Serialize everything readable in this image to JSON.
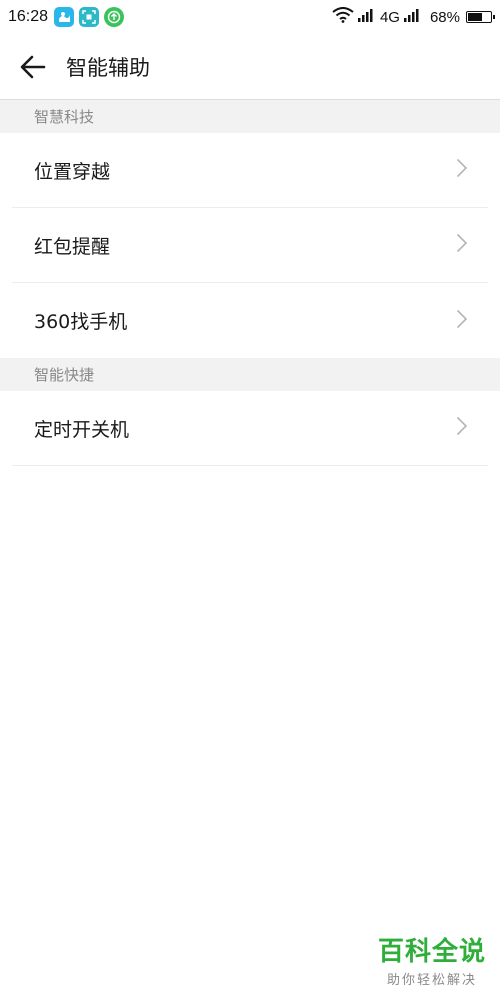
{
  "status_bar": {
    "time": "16:28",
    "network": "4G",
    "battery": "68%",
    "battery_level": 0.68,
    "notification_icons": [
      {
        "name": "ocean-app-icon",
        "color": "#29b6e8"
      },
      {
        "name": "scan-app-icon",
        "color": "#2bb8c8"
      },
      {
        "name": "upload-app-icon",
        "color": "#3ac35a"
      }
    ]
  },
  "header": {
    "title": "智能辅助",
    "back_icon": "arrow-left-icon"
  },
  "sections": [
    {
      "title": "智慧科技",
      "items": [
        "位置穿越",
        "红包提醒",
        "360找手机"
      ]
    },
    {
      "title": "智能快捷",
      "items": [
        "定时开关机"
      ]
    }
  ],
  "watermark": {
    "title": "百科全说",
    "subtitle": "助你轻松解决",
    "color": "#2fae3a"
  }
}
